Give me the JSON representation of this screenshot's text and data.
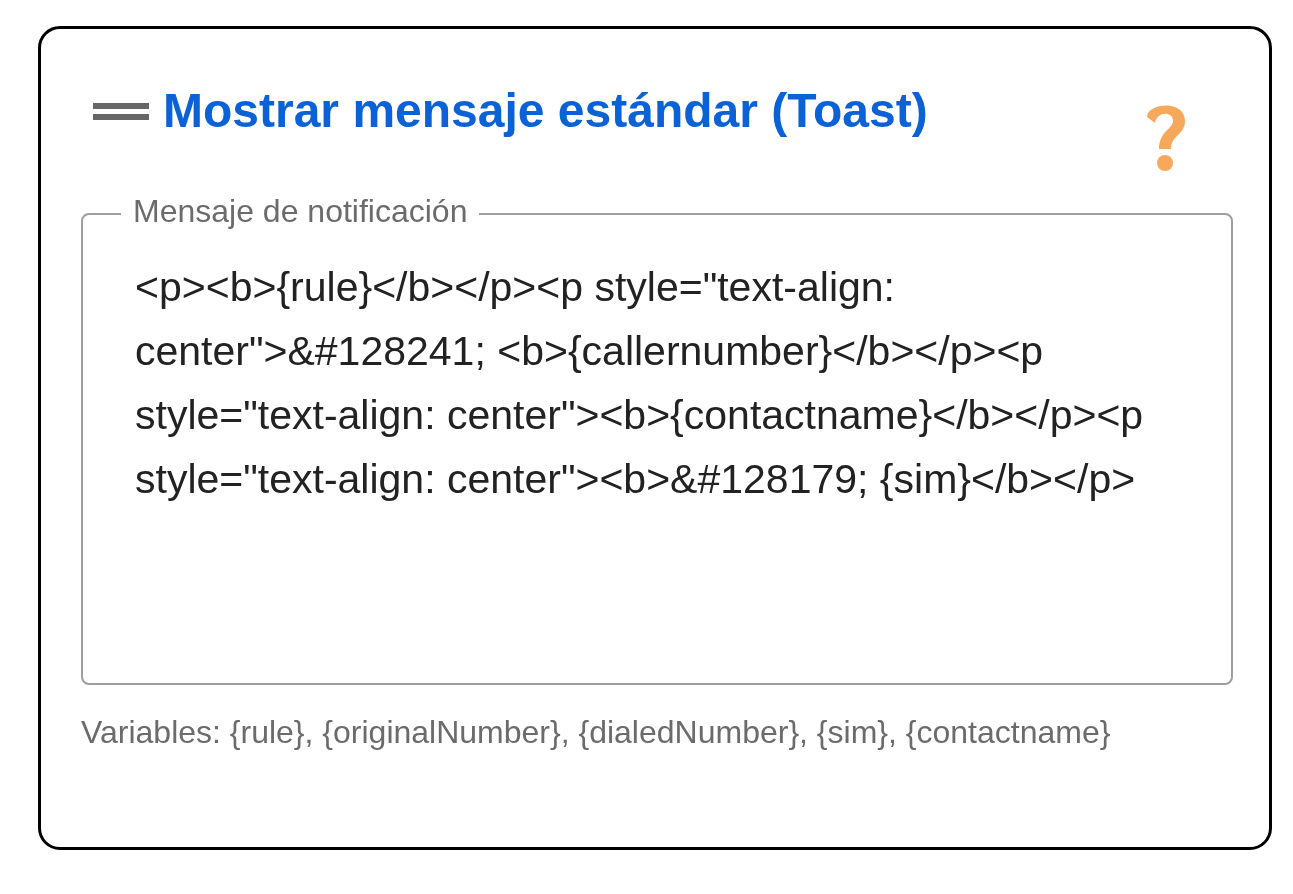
{
  "title": "Mostrar mensaje estándar (Toast)",
  "field": {
    "label": "Mensaje de notificación",
    "value": "<p><b>{rule}</b></p><p style=\"text-align: center\">&#128241; <b>{callernumber}</b></p><p style=\"text-align: center\"><b>{contactname}</b></p><p style=\"text-align: center\"><b>&#128179; {sim}</b></p>"
  },
  "hint": "Variables: {rule}, {originalNumber}, {dialedNumber}, {sim}, {contactname}"
}
